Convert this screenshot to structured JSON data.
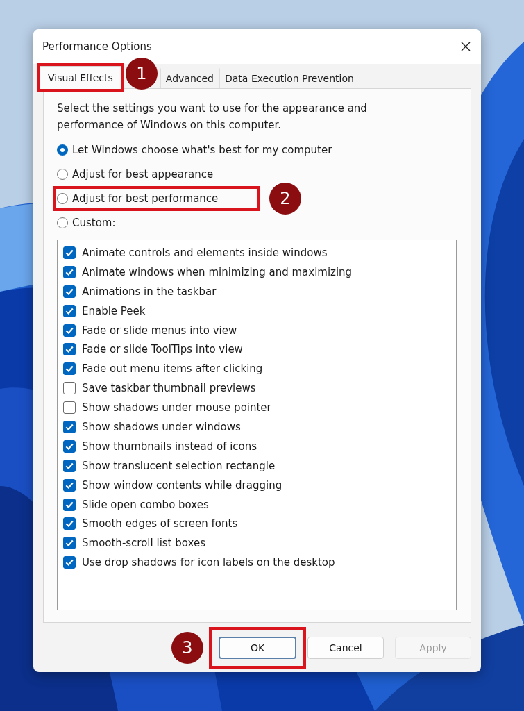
{
  "window": {
    "title": "Performance Options"
  },
  "tabs": [
    {
      "label": "Visual Effects",
      "selected": true,
      "annotation": "1"
    },
    {
      "label": "Advanced",
      "selected": false
    },
    {
      "label": "Data Execution Prevention",
      "selected": false
    }
  ],
  "description": "Select the settings you want to use for the appearance and performance of Windows on this computer.",
  "options": [
    {
      "label": "Let Windows choose what's best for my computer",
      "selected": true
    },
    {
      "label": "Adjust for best appearance",
      "selected": false
    },
    {
      "label": "Adjust for best performance",
      "selected": false,
      "annotation": "2"
    },
    {
      "label": "Custom:",
      "selected": false
    }
  ],
  "effects": [
    {
      "label": "Animate controls and elements inside windows",
      "checked": true
    },
    {
      "label": "Animate windows when minimizing and maximizing",
      "checked": true
    },
    {
      "label": "Animations in the taskbar",
      "checked": true
    },
    {
      "label": "Enable Peek",
      "checked": true
    },
    {
      "label": "Fade or slide menus into view",
      "checked": true
    },
    {
      "label": "Fade or slide ToolTips into view",
      "checked": true
    },
    {
      "label": "Fade out menu items after clicking",
      "checked": true
    },
    {
      "label": "Save taskbar thumbnail previews",
      "checked": false
    },
    {
      "label": "Show shadows under mouse pointer",
      "checked": false
    },
    {
      "label": "Show shadows under windows",
      "checked": true
    },
    {
      "label": "Show thumbnails instead of icons",
      "checked": true
    },
    {
      "label": "Show translucent selection rectangle",
      "checked": true
    },
    {
      "label": "Show window contents while dragging",
      "checked": true
    },
    {
      "label": "Slide open combo boxes",
      "checked": true
    },
    {
      "label": "Smooth edges of screen fonts",
      "checked": true
    },
    {
      "label": "Smooth-scroll list boxes",
      "checked": true
    },
    {
      "label": "Use drop shadows for icon labels on the desktop",
      "checked": true
    }
  ],
  "buttons": [
    {
      "label": "OK",
      "kind": "default",
      "annotation": "3"
    },
    {
      "label": "Cancel",
      "kind": "normal"
    },
    {
      "label": "Apply",
      "kind": "disabled"
    }
  ]
}
